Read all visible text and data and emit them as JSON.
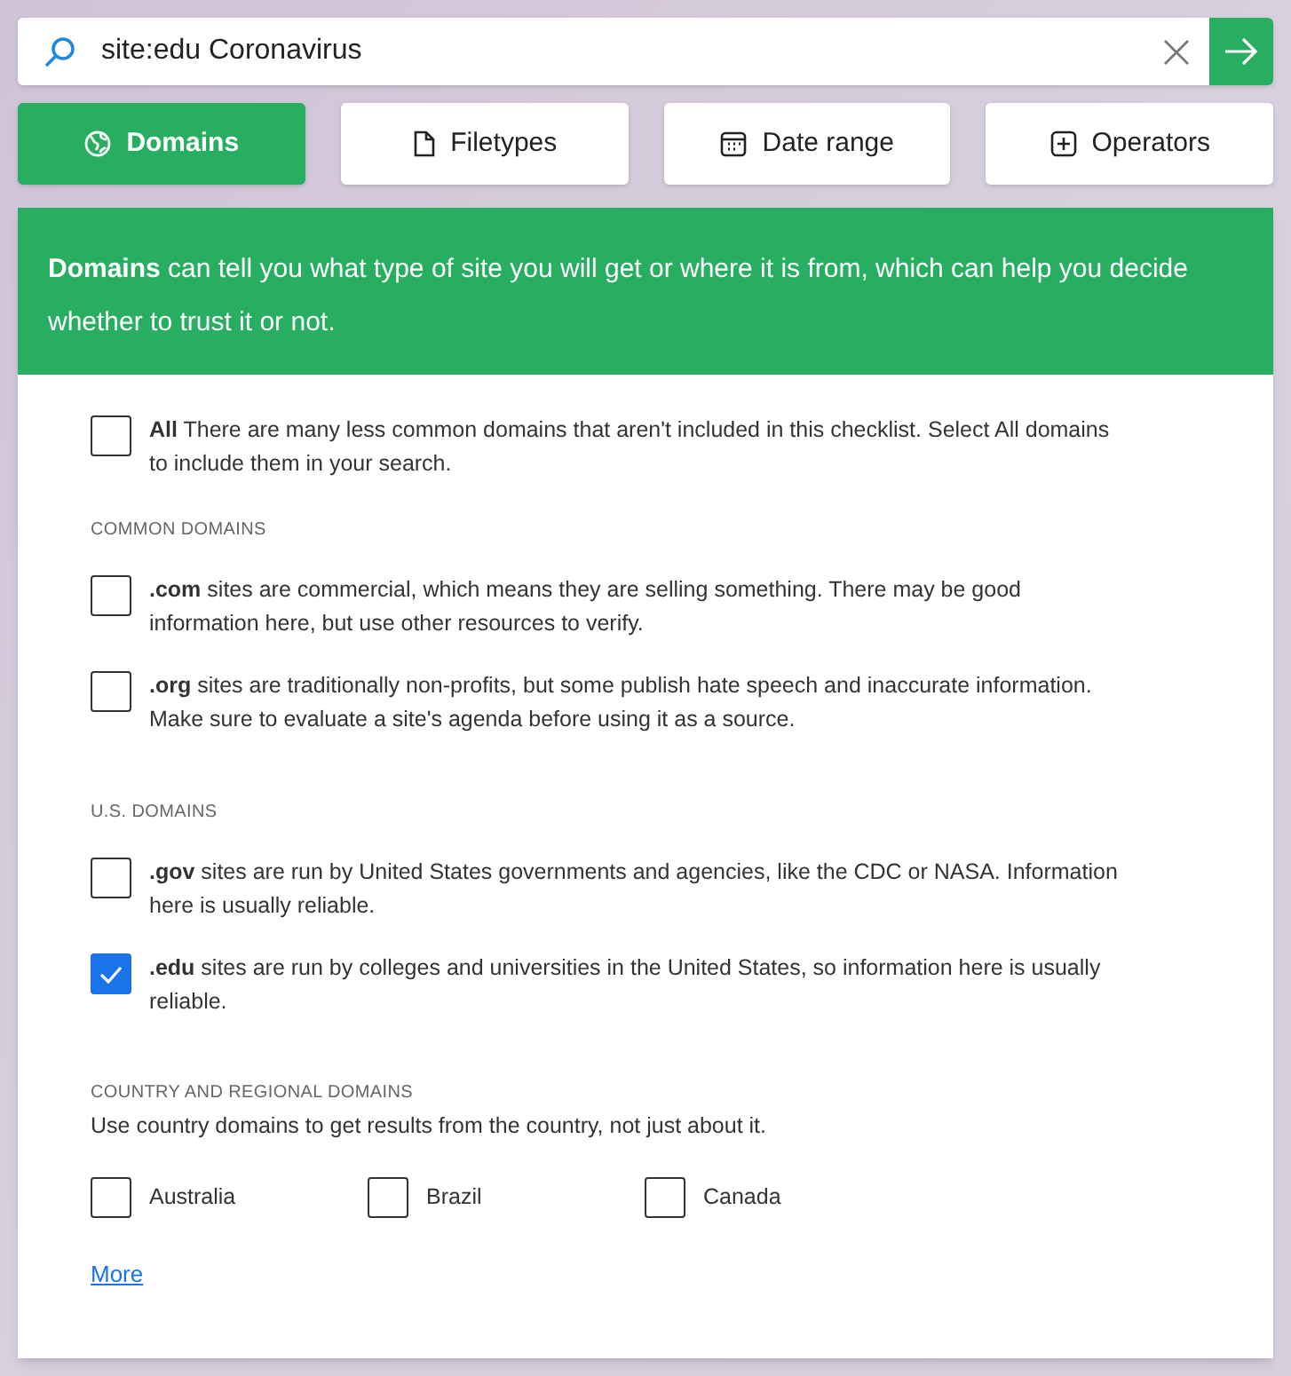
{
  "search": {
    "value": "site:edu Coronavirus"
  },
  "tabs": [
    {
      "label": "Domains",
      "selected": true
    },
    {
      "label": "Filetypes",
      "selected": false
    },
    {
      "label": "Date range",
      "selected": false
    },
    {
      "label": "Operators",
      "selected": false
    }
  ],
  "banner": "**Domains**  can tell you what type of site you will get or where it is from, which can help you decide whether to trust it or not.",
  "all_option": {
    "text": "**All** There are many less common domains that aren't included in this checklist. Select All domains to include them in your search.",
    "checked": false
  },
  "sections": [
    {
      "heading": "COMMON DOMAINS",
      "options": [
        {
          "text": "**.com** sites are commercial, which means they are selling something. There may be good information here, but use other resources to verify.",
          "checked": false
        },
        {
          "text": "**.org** sites are traditionally non-profits, but some publish hate speech and inaccurate information. Make sure to evaluate a site's agenda before using it as a source.",
          "checked": false
        }
      ]
    },
    {
      "heading": "U.S. DOMAINS",
      "options": [
        {
          "text": "**.gov** sites are run by United States governments and agencies, like the CDC or NASA. Information here is usually reliable.",
          "checked": false
        },
        {
          "text": "**.edu** sites are run by colleges and universities in the United States, so information here is usually reliable.",
          "checked": true
        }
      ]
    }
  ],
  "country": {
    "heading": "COUNTRY AND REGIONAL DOMAINS",
    "description": "Use country domains to get results from the country, not just about it.",
    "options": [
      {
        "label": "Australia",
        "checked": false
      },
      {
        "label": "Brazil",
        "checked": false
      },
      {
        "label": "Canada",
        "checked": false
      }
    ]
  },
  "more_link": "More"
}
